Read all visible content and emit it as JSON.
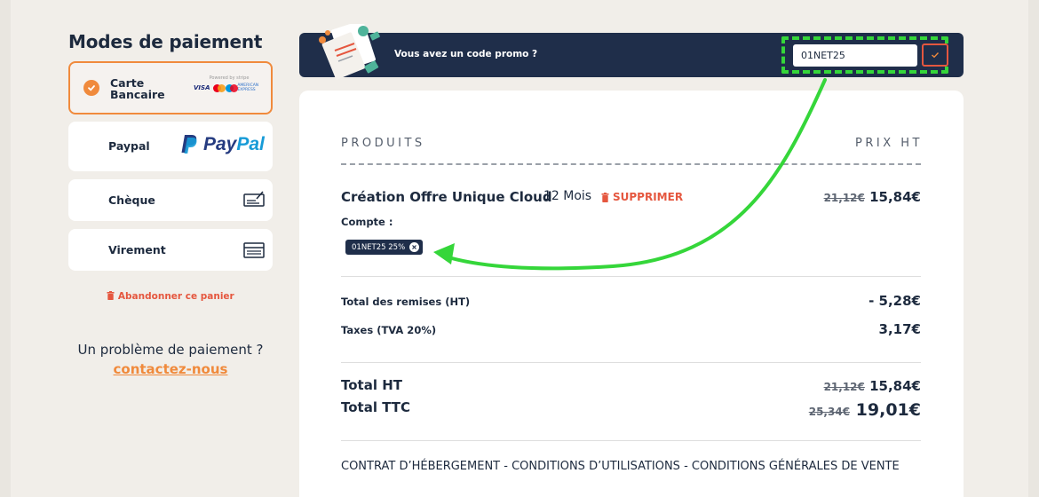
{
  "payment": {
    "title": "Modes de paiement",
    "methods": [
      {
        "label": "Carte Bancaire",
        "line1": "Carte",
        "line2": "Bancaire",
        "selected": true,
        "logos": {
          "powered": "Powered by stripe",
          "visa": "VISA",
          "amex": "AMERICAN EXPRESS"
        }
      },
      {
        "label": "Paypal",
        "selected": false,
        "logo_a": "Pay",
        "logo_b": "Pal"
      },
      {
        "label": "Chèque",
        "selected": false,
        "icon": "cheque-icon"
      },
      {
        "label": "Virement",
        "selected": false,
        "icon": "bank-transfer-icon"
      }
    ],
    "abandon": "Abandonner ce panier",
    "help_text": "Un problème de paiement ?",
    "help_link": "contactez-nous"
  },
  "promo": {
    "question": "Vous avez un code promo ?",
    "code_value": "01NET25",
    "highlight_color": "#35d63a"
  },
  "order": {
    "col_products": "PRODUITS",
    "col_price": "PRIX HT",
    "product": {
      "name": "Création Offre Unique Cloud",
      "duration": "12 Mois",
      "remove_label": "SUPPRIMER",
      "old_price": "21,12€",
      "price": "15,84€"
    },
    "account_label": "Compte :",
    "applied_code": "01NET25 25%",
    "discounts_label": "Total des remises (HT)",
    "discounts_value": "- 5,28€",
    "taxes_label": "Taxes (TVA 20%)",
    "taxes_value": "3,17€",
    "total_ht_label": "Total HT",
    "total_ht_old": "21,12€",
    "total_ht": "15,84€",
    "total_ttc_label": "Total TTC",
    "total_ttc_old": "25,34€",
    "total_ttc": "19,01€",
    "legal": "CONTRAT D’HÉBERGEMENT - CONDITIONS D’UTILISATIONS - CONDITIONS GÉNÉRALES DE VENTE"
  },
  "colors": {
    "accent": "#f08a3c",
    "navy": "#1f2e4a",
    "danger": "#e5573f",
    "annotation": "#35d63a"
  }
}
